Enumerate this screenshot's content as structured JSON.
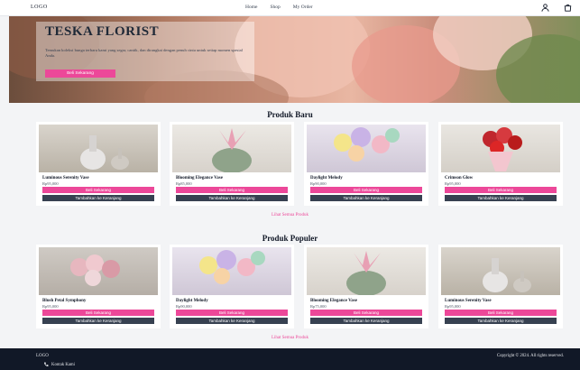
{
  "nav": {
    "logo": "LOGO",
    "menu": [
      "Home",
      "Shop",
      "My Order"
    ],
    "icons": [
      "user-icon",
      "cart-icon"
    ]
  },
  "hero": {
    "title": "TESKA FLORIST",
    "text": "Temukan koleksi bunga terbaru kami yang segar, cantik, dan dirangkai dengan penuh cinta untuk setiap momen spesial Anda.",
    "button": "Beli Sekarang"
  },
  "sections": [
    {
      "title": "Produk Baru",
      "see_all": "Lihat Semua Produk",
      "products": [
        {
          "name": "Luminous Serenity Vase",
          "price": "Rp95,000"
        },
        {
          "name": "Blooming Elegance Vase",
          "price": "Rp85,000"
        },
        {
          "name": "Daylight Melody",
          "price": "Rp90,000"
        },
        {
          "name": "Crimson Glow",
          "price": "Rp95,000"
        }
      ]
    },
    {
      "title": "Produk Populer",
      "see_all": "Lihat Semua Produk",
      "products": [
        {
          "name": "Blush Petal Symphony",
          "price": "Rp95,000"
        },
        {
          "name": "Daylight Melody",
          "price": "Rp90,000"
        },
        {
          "name": "Blooming Elegance Vase",
          "price": "Rp75,000"
        },
        {
          "name": "Luminous Serenity Vase",
          "price": "Rp95,000"
        }
      ]
    }
  ],
  "buttons": {
    "buy": "Beli Sekarang",
    "cart": "Tambahkan ke Keranjang"
  },
  "footer": {
    "logo": "LOGO",
    "contact": "Kontak Kami",
    "contact_icon": "phone-icon",
    "copyright": "Copyright © 2024. All rights reserved."
  },
  "colors": {
    "accent": "#ec4899",
    "dark": "#374151",
    "footer": "#111827"
  }
}
